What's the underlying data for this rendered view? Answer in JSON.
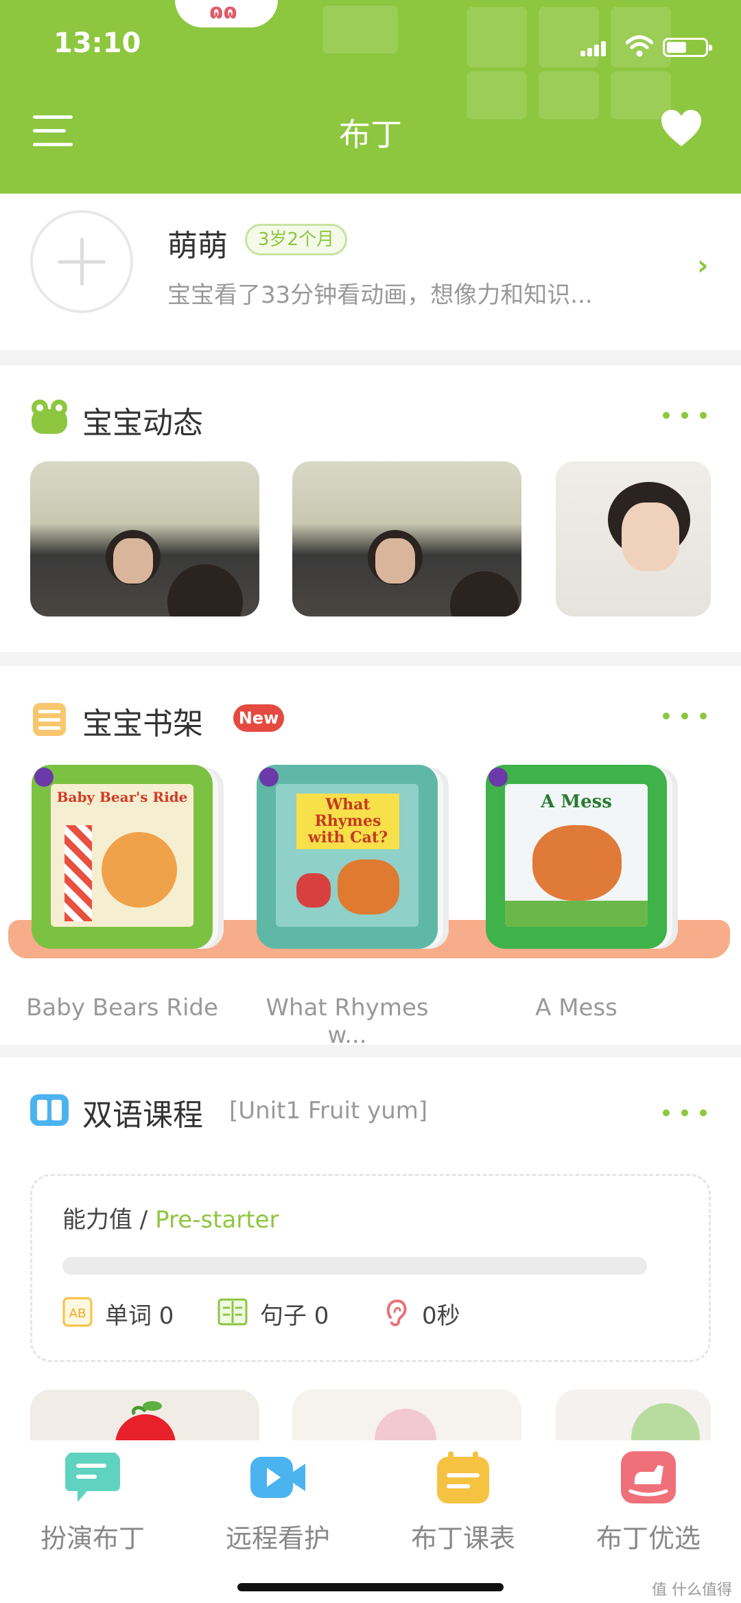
{
  "status_bar": {
    "time": "13:10"
  },
  "header": {
    "title": "布丁",
    "bubble_text": "ɷɷ"
  },
  "profile": {
    "name": "萌萌",
    "age": "3岁2个月",
    "description": "宝宝看了33分钟看动画，想像力和知识..."
  },
  "dynamics": {
    "title": "宝宝动态"
  },
  "bookshelf": {
    "title": "宝宝书架",
    "badge": "New",
    "books": [
      {
        "label": "Baby Bears Ride",
        "cover_title": "Baby Bear's Ride",
        "color": "#7cc242"
      },
      {
        "label": "What Rhymes w...",
        "cover_title": "What Rhymes with Cat?",
        "color": "#5fb8a6"
      },
      {
        "label": "A Mess",
        "cover_title": "A Mess",
        "color": "#3fb24a"
      }
    ]
  },
  "course": {
    "title": "双语课程",
    "subtitle": "[Unit1 Fruit yum]",
    "ability_label": "能力值 / ",
    "ability_level": "Pre-starter",
    "progress": 0,
    "stats": {
      "words": "单词 0",
      "sentences": "句子 0",
      "listening": "0秒"
    }
  },
  "tabs": [
    {
      "label": "扮演布丁",
      "icon": "chat-bubble-icon",
      "color": "#5fd3c0"
    },
    {
      "label": "远程看护",
      "icon": "video-camera-icon",
      "color": "#4bb3f0"
    },
    {
      "label": "布丁课表",
      "icon": "calendar-icon",
      "color": "#f5c242"
    },
    {
      "label": "布丁优选",
      "icon": "rocking-horse-icon",
      "color": "#f0707a"
    }
  ],
  "watermark": "值 什么值得买",
  "colors": {
    "brand_green": "#8dc63f",
    "new_badge": "#e44a40",
    "shelf": "#f7ad89"
  }
}
